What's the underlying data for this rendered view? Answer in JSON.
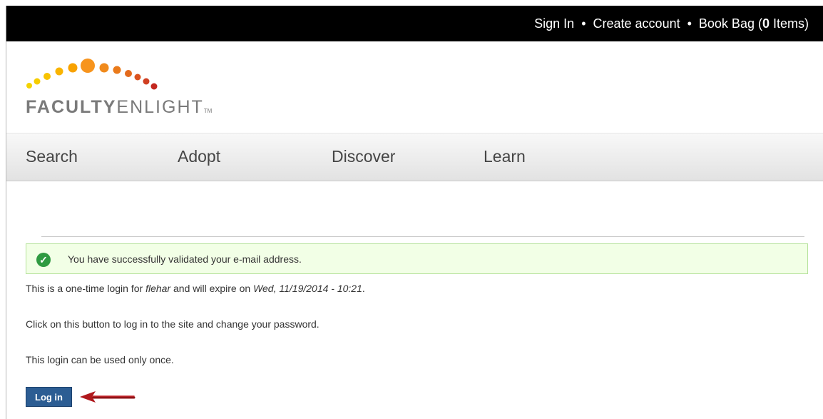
{
  "topbar": {
    "sign_in": "Sign In",
    "separator": "•",
    "create_account": "Create account",
    "book_bag_prefix": "Book Bag (",
    "book_bag_count": "0",
    "book_bag_suffix": " Items)"
  },
  "logo": {
    "text_bold": "FACULTY",
    "text_light": "ENLIGHT",
    "trademark": "TM"
  },
  "nav": {
    "items": [
      {
        "label": "Search"
      },
      {
        "label": "Adopt"
      },
      {
        "label": "Discover"
      },
      {
        "label": "Learn"
      }
    ]
  },
  "status": {
    "message": "You have successfully validated your e-mail address."
  },
  "content": {
    "line1_prefix": "This is a one-time login for ",
    "username": "flehar",
    "line1_mid": " and will expire on ",
    "expiry": "Wed, 11/19/2014 - 10:21",
    "line1_suffix": ".",
    "line2": "Click on this button to log in to the site and change your password.",
    "line3": "This login can be used only once."
  },
  "actions": {
    "login_label": "Log in"
  },
  "colors": {
    "topbar_bg": "#000000",
    "button_bg": "#2c5d93",
    "success_bg": "#f2ffe6",
    "success_icon": "#2f9a41",
    "arrow": "#b0181c"
  },
  "icons": {
    "status": "check-circle-icon",
    "pointer": "arrow-left-icon"
  }
}
